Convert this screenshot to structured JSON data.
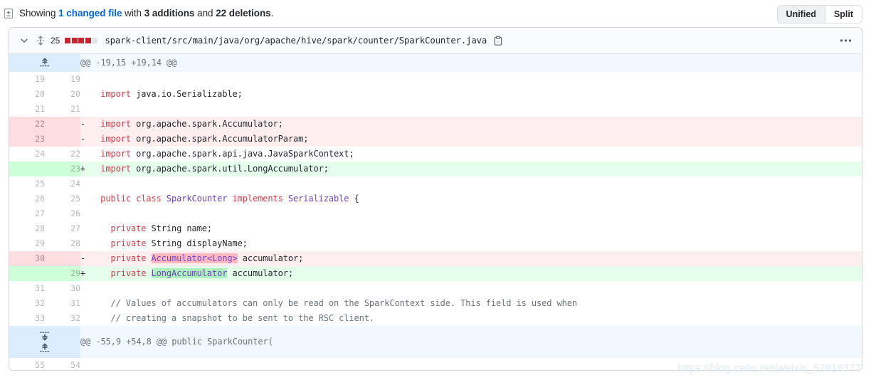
{
  "summary": {
    "icon": "diff-file-icon",
    "prefix": "Showing ",
    "changed_file_link": "1 changed file",
    "middle": " with ",
    "additions": "3 additions",
    "conjunction": " and ",
    "deletions": "22 deletions",
    "suffix": "."
  },
  "view_toggle": {
    "unified_label": "Unified",
    "split_label": "Split",
    "selected": "Unified"
  },
  "file_header": {
    "change_count": "25",
    "stat_blocks": [
      "#cb2431",
      "#cb2431",
      "#cb2431",
      "#cb2431",
      "#e1e4e8"
    ],
    "path": "spark-client/src/main/java/org/apache/hive/spark/counter/SparkCounter.java"
  },
  "colors": {
    "link": "#0366d6",
    "deletion_bg": "#ffeef0",
    "deletion_gutter": "#ffdce0",
    "deletion_word": "#fdb8c0",
    "addition_bg": "#e6ffed",
    "addition_gutter": "#cdffd8",
    "addition_word": "#acf2bd",
    "hunk_bg": "#f1f8ff",
    "hunk_gutter": "#dbedff",
    "keyword": "#d73a49",
    "type": "#6f42c1",
    "comment": "#6a737d",
    "stat_deleted": "#cb2431",
    "stat_neutral": "#e1e4e8"
  },
  "hunks": [
    {
      "header": "@@ -19,15 +19,14 @@",
      "expander": "up"
    },
    {
      "header": "@@ -55,9 +54,8 @@ public SparkCounter(",
      "expander": "both"
    }
  ],
  "rows": [
    {
      "type": "hunk",
      "hunk_index": 0
    },
    {
      "type": "ctx",
      "old": "19",
      "new": "19",
      "marker": " ",
      "segments": []
    },
    {
      "type": "ctx",
      "old": "20",
      "new": "20",
      "marker": " ",
      "segments": [
        {
          "t": "  ",
          "c": "pl"
        },
        {
          "t": "import",
          "c": "k"
        },
        {
          "t": " java.io.Serializable;",
          "c": "pl"
        }
      ]
    },
    {
      "type": "ctx",
      "old": "21",
      "new": "21",
      "marker": " ",
      "segments": []
    },
    {
      "type": "del",
      "old": "22",
      "new": "",
      "marker": "-",
      "segments": [
        {
          "t": "  ",
          "c": "pl"
        },
        {
          "t": "import",
          "c": "k"
        },
        {
          "t": " org.apache.spark.Accumulator;",
          "c": "pl"
        }
      ]
    },
    {
      "type": "del",
      "old": "23",
      "new": "",
      "marker": "-",
      "segments": [
        {
          "t": "  ",
          "c": "pl"
        },
        {
          "t": "import",
          "c": "k"
        },
        {
          "t": " org.apache.spark.AccumulatorParam;",
          "c": "pl"
        }
      ]
    },
    {
      "type": "ctx",
      "old": "24",
      "new": "22",
      "marker": " ",
      "segments": [
        {
          "t": "  ",
          "c": "pl"
        },
        {
          "t": "import",
          "c": "k"
        },
        {
          "t": " org.apache.spark.api.java.JavaSparkContext;",
          "c": "pl"
        }
      ]
    },
    {
      "type": "add",
      "old": "",
      "new": "23",
      "marker": "+",
      "segments": [
        {
          "t": "  ",
          "c": "pl"
        },
        {
          "t": "import",
          "c": "k"
        },
        {
          "t": " org.apache.spark.util.LongAccumulator;",
          "c": "pl"
        }
      ]
    },
    {
      "type": "ctx",
      "old": "25",
      "new": "24",
      "marker": " ",
      "segments": []
    },
    {
      "type": "ctx",
      "old": "26",
      "new": "25",
      "marker": " ",
      "segments": [
        {
          "t": "  ",
          "c": "pl"
        },
        {
          "t": "public",
          "c": "k"
        },
        {
          "t": " ",
          "c": "pl"
        },
        {
          "t": "class",
          "c": "k"
        },
        {
          "t": " ",
          "c": "pl"
        },
        {
          "t": "SparkCounter",
          "c": "t"
        },
        {
          "t": " ",
          "c": "pl"
        },
        {
          "t": "implements",
          "c": "k"
        },
        {
          "t": " ",
          "c": "pl"
        },
        {
          "t": "Serializable",
          "c": "t"
        },
        {
          "t": " {",
          "c": "pl"
        }
      ]
    },
    {
      "type": "ctx",
      "old": "27",
      "new": "26",
      "marker": " ",
      "segments": []
    },
    {
      "type": "ctx",
      "old": "28",
      "new": "27",
      "marker": " ",
      "segments": [
        {
          "t": "    ",
          "c": "pl"
        },
        {
          "t": "private",
          "c": "k"
        },
        {
          "t": " String name;",
          "c": "pl"
        }
      ]
    },
    {
      "type": "ctx",
      "old": "29",
      "new": "28",
      "marker": " ",
      "segments": [
        {
          "t": "    ",
          "c": "pl"
        },
        {
          "t": "private",
          "c": "k"
        },
        {
          "t": " String displayName;",
          "c": "pl"
        }
      ]
    },
    {
      "type": "del",
      "old": "30",
      "new": "",
      "marker": "-",
      "segments": [
        {
          "t": "    ",
          "c": "pl"
        },
        {
          "t": "private",
          "c": "k"
        },
        {
          "t": " ",
          "c": "pl"
        },
        {
          "t": "Accumulator<Long>",
          "c": "t",
          "hl": "wd"
        },
        {
          "t": " accumulator;",
          "c": "pl"
        }
      ]
    },
    {
      "type": "add",
      "old": "",
      "new": "29",
      "marker": "+",
      "segments": [
        {
          "t": "    ",
          "c": "pl"
        },
        {
          "t": "private",
          "c": "k"
        },
        {
          "t": " ",
          "c": "pl"
        },
        {
          "t": "LongAccumulator",
          "c": "t",
          "hl": "wa"
        },
        {
          "t": " accumulator;",
          "c": "pl"
        }
      ]
    },
    {
      "type": "ctx",
      "old": "31",
      "new": "30",
      "marker": " ",
      "segments": []
    },
    {
      "type": "ctx",
      "old": "32",
      "new": "31",
      "marker": " ",
      "segments": [
        {
          "t": "    // Values of accumulators can only be read on the SparkContext side. This field is used when",
          "c": "c"
        }
      ]
    },
    {
      "type": "ctx",
      "old": "33",
      "new": "32",
      "marker": " ",
      "segments": [
        {
          "t": "    // creating a snapshot to be sent to the RSC client.",
          "c": "c"
        }
      ]
    },
    {
      "type": "hunk",
      "hunk_index": 1
    },
    {
      "type": "ctx",
      "old": "55",
      "new": "54",
      "marker": " ",
      "segments": []
    }
  ],
  "watermark": "https://blog.csdn.net/weixin_52918377"
}
